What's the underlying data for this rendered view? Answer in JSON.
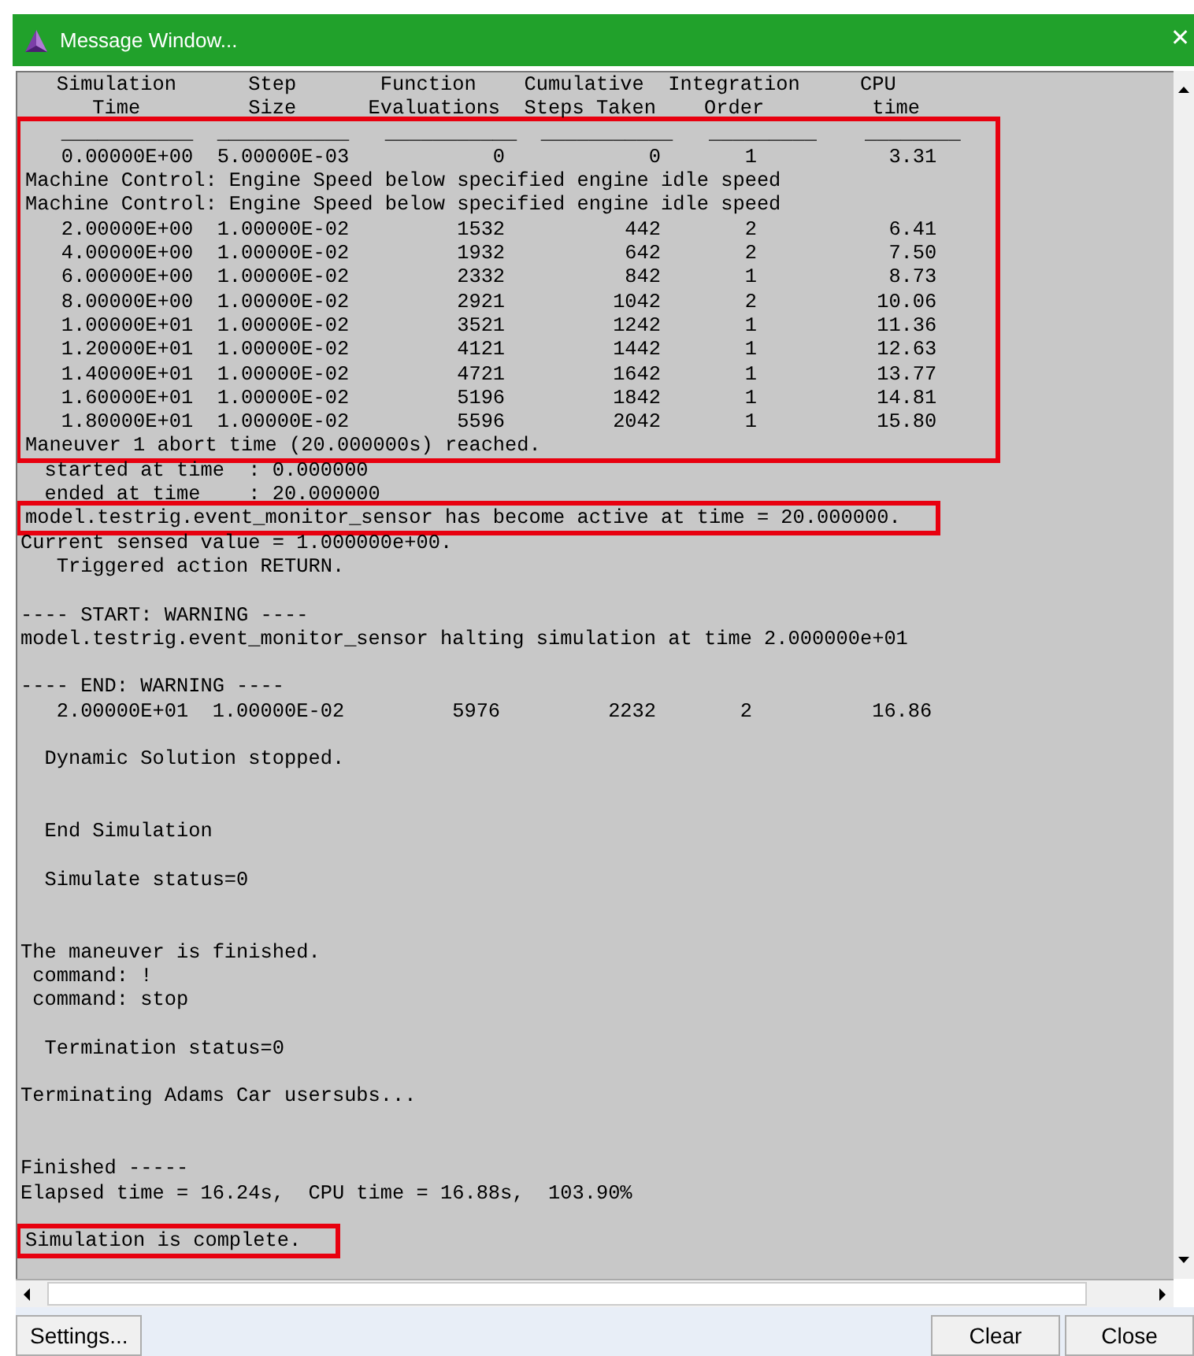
{
  "window": {
    "title": "Message Window...",
    "close": "✕"
  },
  "log": [
    {
      "highlighted": false,
      "lines": [
        {
          "kind": "text",
          "text": "   Simulation      Step       Function    Cumulative  Integration     CPU"
        },
        {
          "kind": "text",
          "text": "      Time         Size      Evaluations  Steps Taken    Order         time"
        }
      ]
    },
    {
      "highlighted": true,
      "lines": [
        {
          "kind": "text",
          "text": "   ___________  ___________   ___________  ___________   _________    ________"
        },
        {
          "kind": "text",
          "text": "   0.00000E+00  5.00000E-03            0            0       1           3.31"
        },
        {
          "kind": "text",
          "text": "Machine Control: Engine Speed below specified engine idle speed"
        },
        {
          "kind": "text",
          "text": "Machine Control: Engine Speed below specified engine idle speed"
        },
        {
          "kind": "text",
          "text": "   2.00000E+00  1.00000E-02         1532          442       2           6.41"
        },
        {
          "kind": "text",
          "text": "   4.00000E+00  1.00000E-02         1932          642       2           7.50"
        },
        {
          "kind": "text",
          "text": "   6.00000E+00  1.00000E-02         2332          842       1           8.73"
        },
        {
          "kind": "text",
          "text": "   8.00000E+00  1.00000E-02         2921         1042       2          10.06"
        },
        {
          "kind": "text",
          "text": "   1.00000E+01  1.00000E-02         3521         1242       1          11.36"
        },
        {
          "kind": "text",
          "text": "   1.20000E+01  1.00000E-02         4121         1442       1          12.63"
        },
        {
          "kind": "text",
          "text": "   1.40000E+01  1.00000E-02         4721         1642       1          13.77"
        },
        {
          "kind": "text",
          "text": "   1.60000E+01  1.00000E-02         5196         1842       1          14.81"
        },
        {
          "kind": "text",
          "text": "   1.80000E+01  1.00000E-02         5596         2042       1          15.80"
        },
        {
          "kind": "text",
          "text": "Maneuver 1 abort time (20.000000s) reached."
        }
      ]
    },
    {
      "highlighted": false,
      "lines": [
        {
          "kind": "text",
          "text": "  started at time  : 0.000000"
        },
        {
          "kind": "text",
          "text": "  ended at time    : 20.000000"
        }
      ]
    },
    {
      "highlighted": true,
      "lines": [
        {
          "kind": "text",
          "text": "model.testrig.event_monitor_sensor has become active at time = 20.000000."
        }
      ]
    },
    {
      "highlighted": false,
      "lines": [
        {
          "kind": "text",
          "text": "Current sensed value = 1.000000e+00."
        },
        {
          "kind": "text",
          "text": "   Triggered action RETURN."
        },
        {
          "kind": "blank"
        },
        {
          "kind": "text",
          "text": "---- START: WARNING ----"
        },
        {
          "kind": "text",
          "text": "model.testrig.event_monitor_sensor halting simulation at time 2.000000e+01"
        },
        {
          "kind": "blank"
        },
        {
          "kind": "text",
          "text": "---- END: WARNING ----"
        },
        {
          "kind": "text",
          "text": "   2.00000E+01  1.00000E-02         5976         2232       2          16.86"
        },
        {
          "kind": "blank"
        },
        {
          "kind": "text",
          "text": "  Dynamic Solution stopped."
        },
        {
          "kind": "blank"
        },
        {
          "kind": "blank"
        },
        {
          "kind": "text",
          "text": "  End Simulation"
        },
        {
          "kind": "blank"
        },
        {
          "kind": "text",
          "text": "  Simulate status=0"
        },
        {
          "kind": "blank"
        },
        {
          "kind": "blank"
        },
        {
          "kind": "text",
          "text": "The maneuver is finished."
        },
        {
          "kind": "text",
          "text": " command: !"
        },
        {
          "kind": "text",
          "text": " command: stop"
        },
        {
          "kind": "blank"
        },
        {
          "kind": "text",
          "text": "  Termination status=0"
        },
        {
          "kind": "blank"
        },
        {
          "kind": "text",
          "text": "Terminating Adams Car usersubs..."
        },
        {
          "kind": "blank"
        },
        {
          "kind": "blank"
        },
        {
          "kind": "text",
          "text": "Finished -----"
        },
        {
          "kind": "text",
          "text": "Elapsed time = 16.24s,  CPU time = 16.88s,  103.90%"
        },
        {
          "kind": "blank"
        }
      ]
    },
    {
      "highlighted": true,
      "lines": [
        {
          "kind": "text",
          "text": "Simulation is complete."
        }
      ]
    }
  ],
  "left_buttons": [
    "Settings..."
  ],
  "right_buttons": [
    "Clear",
    "Close"
  ]
}
